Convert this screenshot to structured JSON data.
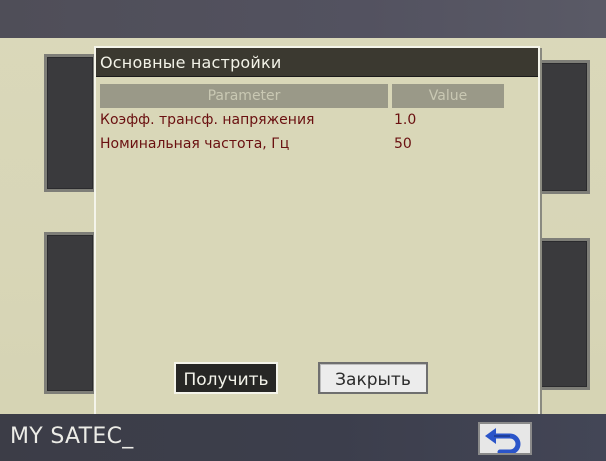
{
  "dialog": {
    "title": "Основные настройки",
    "table": {
      "columns": [
        "Parameter",
        "Value"
      ],
      "rows": [
        {
          "parameter": "Коэфф. трансф. напряжения",
          "value": "1.0"
        },
        {
          "parameter": "Номинальная частота, Гц",
          "value": "50"
        }
      ]
    },
    "buttons": {
      "get_label": "Получить",
      "close_label": "Закрыть"
    }
  },
  "statusbar": {
    "text": "MY SATEC_"
  },
  "icons": {
    "back": "back-arrow-icon"
  },
  "colors": {
    "background": "#d9d7b8",
    "title_bar": "#3b3930",
    "table_header": "#9a9988",
    "table_text": "#6a1010",
    "statusbar": "#3c3e4c"
  }
}
